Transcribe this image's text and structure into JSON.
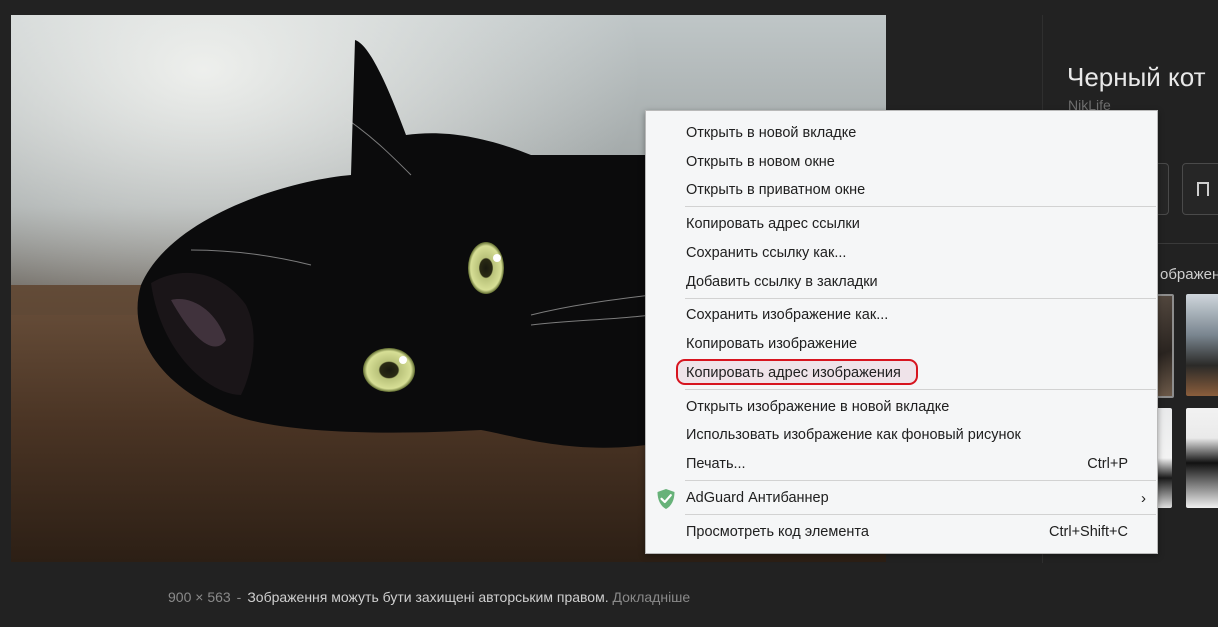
{
  "image": {
    "alt": "Черный кот",
    "dimensions_text": "900 × 563",
    "separator": "-",
    "copyright_notice": "Зображення можуть бути захищені авторським правом.",
    "more_link": "Докладніше"
  },
  "side_panel": {
    "title": "Черный кот",
    "source": "NikLife",
    "related_label": "ображен"
  },
  "context_menu": {
    "items": [
      {
        "label": "Открыть в новой вкладке"
      },
      {
        "label": "Открыть в новом окне"
      },
      {
        "label": "Открыть в приватном окне"
      },
      {
        "label": "Копировать адрес ссылки"
      },
      {
        "label": "Сохранить ссылку как..."
      },
      {
        "label": "Добавить ссылку в закладки"
      },
      {
        "label": "Сохранить изображение как..."
      },
      {
        "label": "Копировать изображение"
      },
      {
        "label": "Копировать адрес изображения",
        "highlighted": true
      },
      {
        "label": "Открыть изображение в новой вкладке"
      },
      {
        "label": "Использовать изображение как фоновый рисунок"
      },
      {
        "label": "Печать...",
        "shortcut": "Ctrl+P"
      },
      {
        "label": "AdGuard Антибаннер",
        "icon": "adguard-shield-icon",
        "submenu": true
      },
      {
        "label": "Просмотреть код элемента",
        "shortcut": "Ctrl+Shift+C"
      }
    ]
  },
  "colors": {
    "page_background": "#222222",
    "menu_background": "#f5f6f7",
    "highlight_border": "#d7141f",
    "adguard_green": "#67b279"
  }
}
